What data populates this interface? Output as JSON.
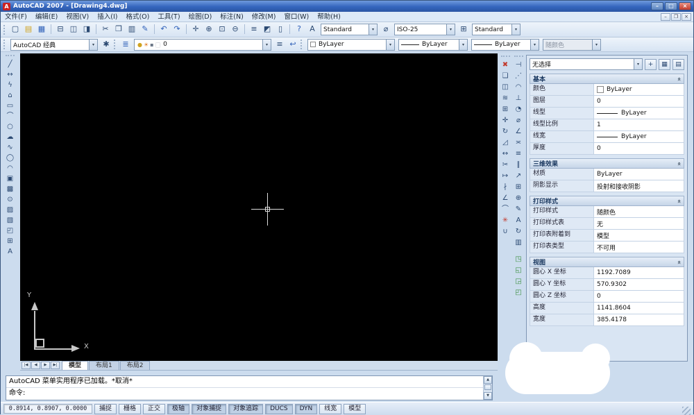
{
  "window": {
    "title": "AutoCAD 2007 - [Drawing4.dwg]",
    "icon_letter": "A",
    "controls": {
      "min": "–",
      "max": "□",
      "close": "×"
    }
  },
  "ui": {
    "dropdown_arrow": "▾",
    "up_arrow": "▲",
    "down_arrow": "▼"
  },
  "menu": {
    "items": [
      "文件(F)",
      "编辑(E)",
      "视图(V)",
      "插入(I)",
      "格式(O)",
      "工具(T)",
      "绘图(D)",
      "标注(N)",
      "修改(M)",
      "窗口(W)",
      "帮助(H)"
    ],
    "mdi": {
      "min": "–",
      "restore": "❐",
      "close": "×"
    }
  },
  "toolbar_standard": {
    "icons": [
      {
        "name": "new-icon",
        "glyph": "▢"
      },
      {
        "name": "open-icon",
        "glyph": "▤",
        "cls": "c-yellow"
      },
      {
        "name": "save-icon",
        "glyph": "▦",
        "cls": "c-blue gpend"
      },
      {
        "name": "plot-icon",
        "glyph": "⊟"
      },
      {
        "name": "plot-preview-icon",
        "glyph": "◫"
      },
      {
        "name": "publish-icon",
        "glyph": "◨",
        "cls": "gpend"
      },
      {
        "name": "cut-icon",
        "glyph": "✂"
      },
      {
        "name": "copy-icon",
        "glyph": "❐"
      },
      {
        "name": "paste-icon",
        "glyph": "▥"
      },
      {
        "name": "match-properties-icon",
        "glyph": "✎",
        "cls": "c-blue gpend"
      },
      {
        "name": "undo-icon",
        "glyph": "↶",
        "cls": "c-blue"
      },
      {
        "name": "redo-icon",
        "glyph": "↷",
        "cls": "c-blue gpend"
      },
      {
        "name": "pan-icon",
        "glyph": "✛"
      },
      {
        "name": "zoom-realtime-icon",
        "glyph": "⊕"
      },
      {
        "name": "zoom-window-icon",
        "glyph": "⊡"
      },
      {
        "name": "zoom-previous-icon",
        "glyph": "⊖",
        "cls": "gpend"
      },
      {
        "name": "properties-palette-icon",
        "glyph": "≡"
      },
      {
        "name": "designcenter-icon",
        "glyph": "◩"
      },
      {
        "name": "tool-palettes-icon",
        "glyph": "▯",
        "cls": "gpend"
      },
      {
        "name": "help-icon",
        "glyph": "?",
        "cls": "c-blue"
      }
    ],
    "style_icons": [
      {
        "name": "text-style-icon",
        "glyph": "A"
      },
      {
        "name": "dim-style-icon",
        "glyph": "⌀"
      },
      {
        "name": "table-style-icon",
        "glyph": "⊞"
      }
    ],
    "text_style_value": "Standard",
    "dim_style_value": "ISO-25",
    "table_style_value": "Standard"
  },
  "toolbar_layers": {
    "workspace_value": "AutoCAD 经典",
    "workspace_icon": {
      "glyph": "✱"
    },
    "layer_manager_icon": {
      "glyph": "≣"
    },
    "mini_icons": [
      {
        "name": "layer-on-bulb-icon",
        "glyph": "●",
        "cls": "c-yellow"
      },
      {
        "name": "layer-freeze-sun-icon",
        "glyph": "☀",
        "cls": "c-orange"
      },
      {
        "name": "layer-lock-icon",
        "glyph": "▪",
        "cls": "c-gray"
      },
      {
        "name": "layer-color-swatch-icon",
        "glyph": "■",
        "cls": "c-white"
      }
    ],
    "layer_value": "0",
    "icons_after_layer": [
      {
        "name": "make-object-layer-current-icon",
        "glyph": "≡"
      },
      {
        "name": "layer-previous-icon",
        "glyph": "↩",
        "cls": "c-blue"
      }
    ],
    "color_value": "ByLayer",
    "linetype_value": "ByLayer",
    "lineweight_value": "ByLayer",
    "plotstyle_value": "随颜色"
  },
  "draw_toolbar": {
    "icons": [
      {
        "name": "line-icon",
        "glyph": "╱"
      },
      {
        "name": "construction-line-icon",
        "glyph": "↔"
      },
      {
        "name": "polyline-icon",
        "glyph": "ϟ"
      },
      {
        "name": "polygon-icon",
        "glyph": "⌂"
      },
      {
        "name": "rectangle-icon",
        "glyph": "▭"
      },
      {
        "name": "arc-icon",
        "glyph": "⌒"
      },
      {
        "name": "circle-icon",
        "glyph": "○"
      },
      {
        "name": "revision-cloud-icon",
        "glyph": "☁"
      },
      {
        "name": "spline-icon",
        "glyph": "∿"
      },
      {
        "name": "ellipse-icon",
        "glyph": "◯"
      },
      {
        "name": "ellipse-arc-icon",
        "glyph": "◠"
      },
      {
        "name": "insert-block-icon",
        "glyph": "▣"
      },
      {
        "name": "make-block-icon",
        "glyph": "▩"
      },
      {
        "name": "point-icon",
        "glyph": "⊙"
      },
      {
        "name": "hatch-icon",
        "glyph": "▨"
      },
      {
        "name": "gradient-icon",
        "glyph": "▧"
      },
      {
        "name": "region-icon",
        "glyph": "◰"
      },
      {
        "name": "table-icon",
        "glyph": "⊞"
      },
      {
        "name": "multiline-text-icon",
        "glyph": "A"
      }
    ]
  },
  "modify_toolbar": {
    "icons": [
      {
        "name": "erase-icon",
        "glyph": "✖",
        "cls": "c-red"
      },
      {
        "name": "copy-object-icon",
        "glyph": "❏"
      },
      {
        "name": "mirror-icon",
        "glyph": "◫"
      },
      {
        "name": "offset-icon",
        "glyph": "≋"
      },
      {
        "name": "array-icon",
        "glyph": "⊞"
      },
      {
        "name": "move-icon",
        "glyph": "✛"
      },
      {
        "name": "rotate-icon",
        "glyph": "↻"
      },
      {
        "name": "scale-icon",
        "glyph": "◿"
      },
      {
        "name": "stretch-icon",
        "glyph": "↔"
      },
      {
        "name": "trim-icon",
        "glyph": "✂"
      },
      {
        "name": "extend-icon",
        "glyph": "↦"
      },
      {
        "name": "break-icon",
        "glyph": "∤"
      },
      {
        "name": "chamfer-icon",
        "glyph": "∠"
      },
      {
        "name": "fillet-icon",
        "glyph": "⌒"
      },
      {
        "name": "explode-icon",
        "glyph": "✳",
        "cls": "c-red"
      },
      {
        "name": "join-icon",
        "glyph": "∪"
      }
    ]
  },
  "dim_toolbar": {
    "icons": [
      {
        "name": "linear-dimension-icon",
        "glyph": "⊣"
      },
      {
        "name": "aligned-dimension-icon",
        "glyph": "⋰"
      },
      {
        "name": "arc-length-dimension-icon",
        "glyph": "◠"
      },
      {
        "name": "ordinate-dimension-icon",
        "glyph": "⊥"
      },
      {
        "name": "radius-dimension-icon",
        "glyph": "◔"
      },
      {
        "name": "diameter-dimension-icon",
        "glyph": "⌀"
      },
      {
        "name": "angular-dimension-icon",
        "glyph": "∠"
      },
      {
        "name": "quick-dimension-icon",
        "glyph": "≍"
      },
      {
        "name": "baseline-dimension-icon",
        "glyph": "≡"
      },
      {
        "name": "continue-dimension-icon",
        "glyph": "∥"
      },
      {
        "name": "quick-leader-icon",
        "glyph": "↗"
      },
      {
        "name": "tolerance-icon",
        "glyph": "⊞"
      },
      {
        "name": "center-mark-icon",
        "glyph": "⊕"
      },
      {
        "name": "dimension-edit-icon",
        "glyph": "✎"
      },
      {
        "name": "dimension-text-edit-icon",
        "glyph": "A"
      },
      {
        "name": "dimension-update-icon",
        "glyph": "↻"
      },
      {
        "name": "dimension-style-icon",
        "glyph": "▥"
      }
    ]
  },
  "order_toolbar": {
    "icons": [
      {
        "name": "bring-to-front-icon",
        "glyph": "◳",
        "cls": "c-green"
      },
      {
        "name": "send-to-back-icon",
        "glyph": "◱",
        "cls": "c-green"
      },
      {
        "name": "bring-above-objects-icon",
        "glyph": "◲",
        "cls": "c-green"
      },
      {
        "name": "send-under-objects-icon",
        "glyph": "◰",
        "cls": "c-green"
      }
    ]
  },
  "canvas": {
    "ucs_x_label": "X",
    "ucs_y_label": "Y"
  },
  "tabs": {
    "arrows": [
      "|◀",
      "◀",
      "▶",
      "▶|"
    ],
    "items": [
      {
        "label": "模型",
        "cls": "active",
        "name": "tab-model"
      },
      {
        "label": "布局1",
        "name": "tab-layout1"
      },
      {
        "label": "布局2",
        "name": "tab-layout2"
      }
    ]
  },
  "command": {
    "history": "AutoCAD 菜单实用程序已加载。*取消*",
    "prompt": "命令:"
  },
  "statusbar": {
    "coords": "0.8914, 0.8907, 0.0000",
    "toggles": [
      {
        "label": "捕捉",
        "name": "snap-toggle"
      },
      {
        "label": "栅格",
        "name": "grid-toggle"
      },
      {
        "label": "正交",
        "name": "ortho-toggle"
      },
      {
        "label": "极轴",
        "name": "polar-toggle",
        "cls": "on"
      },
      {
        "label": "对象捕捉",
        "name": "osnap-toggle",
        "cls": "on"
      },
      {
        "label": "对象追踪",
        "name": "otrack-toggle",
        "cls": "on"
      },
      {
        "label": "DUCS",
        "name": "ducs-toggle",
        "cls": "on"
      },
      {
        "label": "DYN",
        "name": "dyn-toggle",
        "cls": "on"
      },
      {
        "label": "线宽",
        "name": "lineweight-toggle"
      },
      {
        "label": "模型",
        "name": "model-toggle"
      }
    ]
  },
  "properties": {
    "selector": "无选择",
    "chevron": "«",
    "buttons": [
      {
        "name": "toggle-pickadd-button",
        "glyph": "+"
      },
      {
        "name": "quick-select-button",
        "glyph": "▦"
      },
      {
        "name": "quick-calculator-button",
        "glyph": "▤"
      }
    ],
    "sections": [
      {
        "title": "基本",
        "rows": [
          {
            "label": "颜色",
            "value": "ByLayer",
            "cls": "swatch"
          },
          {
            "label": "图层",
            "value": "0"
          },
          {
            "label": "线型",
            "value": "ByLayer",
            "cls": "line"
          },
          {
            "label": "线型比例",
            "value": "1"
          },
          {
            "label": "线宽",
            "value": "ByLayer",
            "cls": "line"
          },
          {
            "label": "厚度",
            "value": "0"
          }
        ]
      },
      {
        "title": "三维效果",
        "rows": [
          {
            "label": "材质",
            "value": "ByLayer"
          },
          {
            "label": "阴影显示",
            "value": "投射和接收阴影"
          }
        ]
      },
      {
        "title": "打印样式",
        "rows": [
          {
            "label": "打印样式",
            "value": "随颜色"
          },
          {
            "label": "打印样式表",
            "value": "无"
          },
          {
            "label": "打印表附着到",
            "value": "模型"
          },
          {
            "label": "打印表类型",
            "value": "不可用"
          }
        ]
      },
      {
        "title": "视图",
        "rows": [
          {
            "label": "圆心 X 坐标",
            "value": "1192.7089"
          },
          {
            "label": "圆心 Y 坐标",
            "value": "570.9302"
          },
          {
            "label": "圆心 Z 坐标",
            "value": "0"
          },
          {
            "label": "高度",
            "value": "1141.8604"
          },
          {
            "label": "宽度",
            "value": "385.4178"
          }
        ]
      }
    ]
  }
}
